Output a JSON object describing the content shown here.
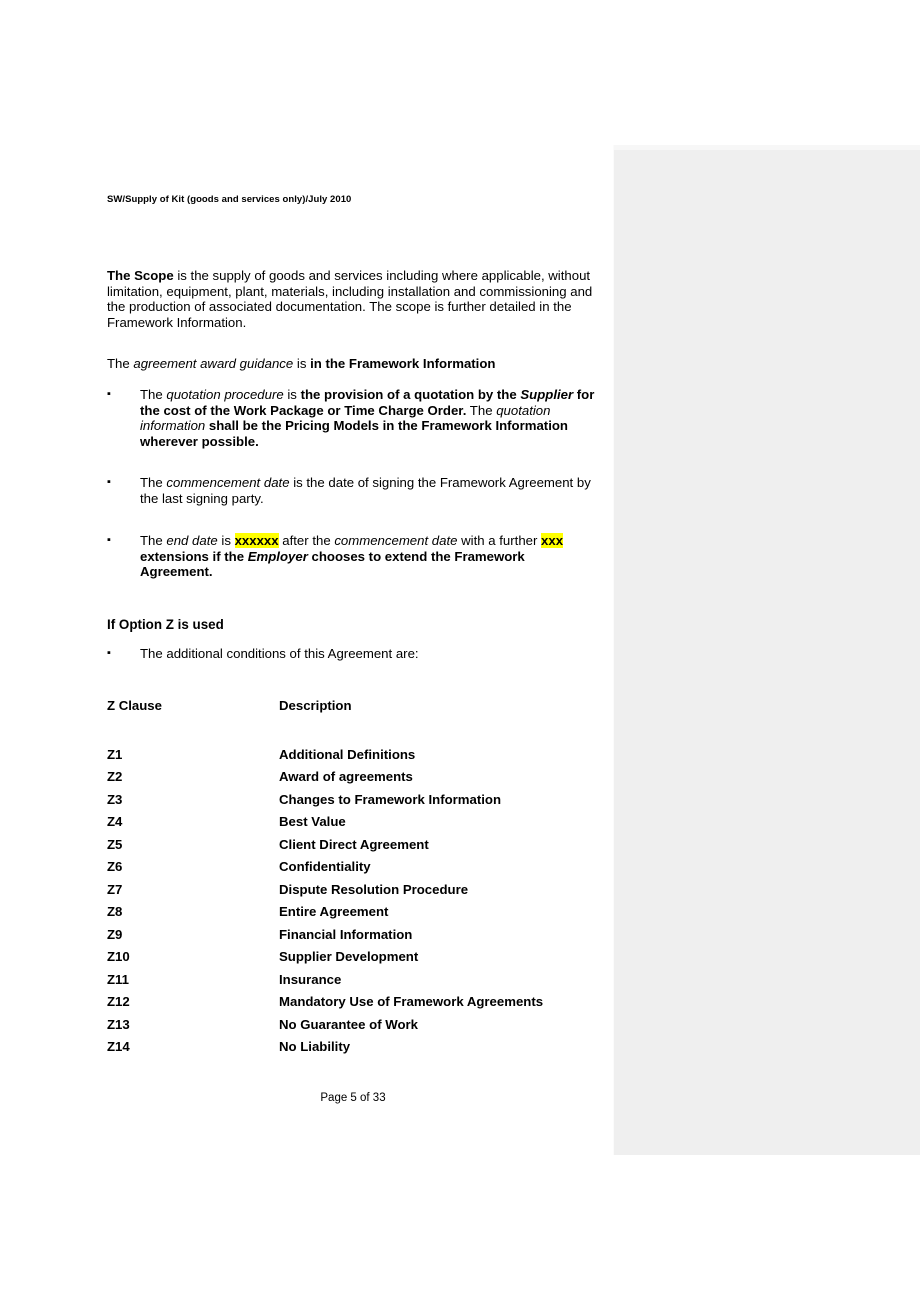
{
  "document": {
    "running_header": "SW/Supply of Kit (goods and services only)/July 2010",
    "footer": "Page 5 of 33"
  },
  "colors": {
    "highlight": "#ffff00",
    "page_background": "#ffffff",
    "adjacent_page": "#efefef",
    "text": "#000000"
  },
  "body": {
    "scope_paragraph": {
      "lead_bold": "The Scope",
      "rest": " is the supply of goods and services including where applicable, without limitation, equipment, plant, materials, including installation and commissioning and the production of associated documentation.  The scope is further detailed in the Framework Information."
    },
    "guidance_line": {
      "prefix": "The ",
      "italic": "agreement award guidance",
      "middle": " is ",
      "bold": "in the Framework Information"
    }
  },
  "bullets": {
    "marker_glyph": "▪",
    "quotation": {
      "p1": "The ",
      "i1": "quotation procedure",
      "p2": " is ",
      "b1": "the provision of a quotation by the ",
      "bi1": "Supplier",
      "b2": " for the cost of the Work Package or Time Charge Order.",
      "p3": " The ",
      "i2": "quotation information",
      "b3": " shall be the Pricing Models in the Framework Information wherever possible."
    },
    "commencement": {
      "p1": "The ",
      "i1": "commencement date",
      "p2": " is the date of signing the Framework Agreement by the last signing party."
    },
    "end_date": {
      "p1": "The ",
      "i1": "end date",
      "p2": " is ",
      "hl1": "xxxxxx",
      "p3": " after the ",
      "i2": "commencement date",
      "p4": " with a further ",
      "hl2": "xxx",
      "b1": " extensions if the ",
      "bi1": "Employer",
      "b2": " chooses to extend the Framework Agreement."
    },
    "additional_conditions": "The additional conditions of this Agreement are:"
  },
  "option_z": {
    "heading": "If Option Z is used",
    "table": {
      "headers": [
        "Z Clause",
        "Description"
      ],
      "rows": [
        [
          "Z1",
          "Additional Definitions"
        ],
        [
          "Z2",
          "Award of agreements"
        ],
        [
          "Z3",
          "Changes to Framework Information"
        ],
        [
          "Z4",
          "Best Value"
        ],
        [
          "Z5",
          "Client Direct Agreement"
        ],
        [
          "Z6",
          "Confidentiality"
        ],
        [
          "Z7",
          "Dispute Resolution Procedure"
        ],
        [
          "Z8",
          "Entire Agreement"
        ],
        [
          "Z9",
          "Financial Information"
        ],
        [
          "Z10",
          "Supplier Development"
        ],
        [
          "Z11",
          "Insurance"
        ],
        [
          "Z12",
          "Mandatory Use of Framework Agreements"
        ],
        [
          "Z13",
          "No Guarantee of Work"
        ],
        [
          "Z14",
          "No Liability"
        ]
      ]
    }
  }
}
